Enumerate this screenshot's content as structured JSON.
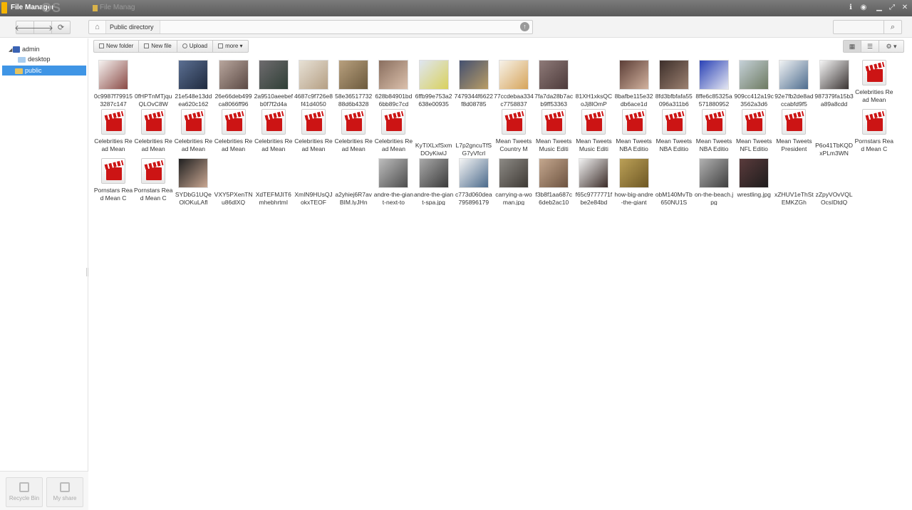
{
  "titlebar": {
    "title": "File Manager",
    "tab": "File Manag",
    "watermark": "OS"
  },
  "nav": {
    "breadcrumb": "Public directory"
  },
  "search": {
    "placeholder": ""
  },
  "tree": {
    "root": "admin",
    "children": [
      "desktop",
      "public"
    ],
    "selected": "public"
  },
  "toolbar": {
    "new_folder": "New folder",
    "new_file": "New file",
    "upload": "Upload",
    "more": "more"
  },
  "sidebar_bottom": {
    "recycle": "Recycle Bin",
    "share": "My share"
  },
  "files": [
    {
      "name": "0c9987f799153287c147",
      "kind": "image",
      "colors": [
        "#f6f3f1",
        "#8a4a45"
      ]
    },
    {
      "name": "0fHPTnMTjquQLOvC8W",
      "kind": "blank",
      "colors": [
        "#ffffff",
        "#ffffff"
      ]
    },
    {
      "name": "21e548e13ddea620c162",
      "kind": "image",
      "colors": [
        "#5b6f92",
        "#1f2a3e"
      ]
    },
    {
      "name": "26e66deb499ca8066ff96",
      "kind": "image",
      "colors": [
        "#b8a69d",
        "#5b4944"
      ]
    },
    {
      "name": "2a9510aeebefb0f7f2d4a",
      "kind": "image",
      "colors": [
        "#6e6b6e",
        "#2f3f36"
      ]
    },
    {
      "name": "4687c9f726e8f41d4050",
      "kind": "image",
      "colors": [
        "#e7e1d5",
        "#b59f84"
      ]
    },
    {
      "name": "58e3651773288d6b4328",
      "kind": "image",
      "colors": [
        "#b8a07e",
        "#6c5a3d"
      ]
    },
    {
      "name": "628b84901bd6bb89c7cd",
      "kind": "image",
      "colors": [
        "#8a6f5f",
        "#dbc0ac"
      ]
    },
    {
      "name": "6ffb99e753a2638e00935",
      "kind": "image",
      "colors": [
        "#dfe6f1",
        "#d9d15d"
      ]
    },
    {
      "name": "7479344f6622f8d08785",
      "kind": "image",
      "colors": [
        "#445070",
        "#b99d66"
      ]
    },
    {
      "name": "77ccdebaa334c7758837",
      "kind": "image",
      "colors": [
        "#f7f2e9",
        "#d6a45a"
      ]
    },
    {
      "name": "7fa7da28b7acb9ff53363",
      "kind": "image",
      "colors": [
        "#8e7a78",
        "#4c3a3a"
      ]
    },
    {
      "name": "81XH1xksQCoJj8lOmP",
      "kind": "blank",
      "colors": [
        "#ffffff",
        "#ffffff"
      ]
    },
    {
      "name": "8bafbe115e32db6ace1d",
      "kind": "image",
      "colors": [
        "#5c3e37",
        "#d2b29e"
      ]
    },
    {
      "name": "8fd3bfbfafa55096a311b6",
      "kind": "image",
      "colors": [
        "#3d2f2b",
        "#9c8170"
      ]
    },
    {
      "name": "8ffe6c85325a571880952",
      "kind": "image",
      "colors": [
        "#2a42b6",
        "#e4e6f2"
      ]
    },
    {
      "name": "909cc412a19c3562a3d6",
      "kind": "image",
      "colors": [
        "#c5d1d8",
        "#6d7a61"
      ]
    },
    {
      "name": "92e7fb2de8adccabfd9f5",
      "kind": "image",
      "colors": [
        "#f1f3f4",
        "#4d6c8e"
      ]
    },
    {
      "name": "987379fa15b3a89a8cdd",
      "kind": "image",
      "colors": [
        "#f6f6f6",
        "#3a3433"
      ]
    },
    {
      "name": "Celebrities Read Mean",
      "kind": "video",
      "colors": []
    },
    {
      "name": "Celebrities Read Mean",
      "kind": "video",
      "colors": []
    },
    {
      "name": "Celebrities Read Mean",
      "kind": "video",
      "colors": []
    },
    {
      "name": "Celebrities Read Mean",
      "kind": "video",
      "colors": []
    },
    {
      "name": "Celebrities Read Mean",
      "kind": "video",
      "colors": []
    },
    {
      "name": "Celebrities Read Mean",
      "kind": "video",
      "colors": []
    },
    {
      "name": "Celebrities Read Mean",
      "kind": "video",
      "colors": []
    },
    {
      "name": "Celebrities Read Mean",
      "kind": "video",
      "colors": []
    },
    {
      "name": "Celebrities Read Mean",
      "kind": "video",
      "colors": []
    },
    {
      "name": "KyTIXLxfSxmDOyKiwiJ",
      "kind": "blank",
      "colors": [
        "#ffffff",
        "#ffffff"
      ]
    },
    {
      "name": "L7p2gncuTfSG7yVfcrl",
      "kind": "blank",
      "colors": [
        "#ffffff",
        "#ffffff"
      ]
    },
    {
      "name": "Mean Tweets Country M",
      "kind": "video",
      "colors": []
    },
    {
      "name": "Mean Tweets Music Editi",
      "kind": "video",
      "colors": []
    },
    {
      "name": "Mean Tweets Music Editi",
      "kind": "video",
      "colors": []
    },
    {
      "name": "Mean Tweets NBA Editio",
      "kind": "video",
      "colors": []
    },
    {
      "name": "Mean Tweets NBA Editio",
      "kind": "video",
      "colors": []
    },
    {
      "name": "Mean Tweets NBA Editio",
      "kind": "video",
      "colors": []
    },
    {
      "name": "Mean Tweets NFL Editio",
      "kind": "video",
      "colors": []
    },
    {
      "name": "Mean Tweets President",
      "kind": "video",
      "colors": []
    },
    {
      "name": "P6o41TbKQDxPLm3WN",
      "kind": "blank",
      "colors": [
        "#ffffff",
        "#ffffff"
      ]
    },
    {
      "name": "Pornstars Read Mean C",
      "kind": "video",
      "colors": []
    },
    {
      "name": "Pornstars Read Mean C",
      "kind": "video",
      "colors": []
    },
    {
      "name": "Pornstars Read Mean C",
      "kind": "video",
      "colors": []
    },
    {
      "name": "SYDbG1UQeOlOKuLAfl",
      "kind": "image",
      "colors": [
        "#202020",
        "#c9a792"
      ]
    },
    {
      "name": "VXY5PXenTNu86dlXQ",
      "kind": "blank",
      "colors": [
        "#ffffff",
        "#ffffff"
      ]
    },
    {
      "name": "XdTEFMJIT6mhebhrtmI",
      "kind": "blank",
      "colors": [
        "#ffffff",
        "#ffffff"
      ]
    },
    {
      "name": "XmIN9HUsQJokxTEOF",
      "kind": "blank",
      "colors": [
        "#ffffff",
        "#ffffff"
      ]
    },
    {
      "name": "a2yhiej6R7avBIM.lyJHn",
      "kind": "blank",
      "colors": [
        "#ffffff",
        "#ffffff"
      ]
    },
    {
      "name": "andre-the-giant-next-to",
      "kind": "image",
      "colors": [
        "#bdbdbd",
        "#4d4d4d"
      ]
    },
    {
      "name": "andre-the-giant-spa.jpg",
      "kind": "image",
      "colors": [
        "#a9a9a9",
        "#3b3b3b"
      ]
    },
    {
      "name": "c773d060dea795896179",
      "kind": "image",
      "colors": [
        "#f5f5f5",
        "#4b6a8b"
      ]
    },
    {
      "name": "carrying-a-woman.jpg",
      "kind": "image",
      "colors": [
        "#8d8a85",
        "#3e3a35"
      ]
    },
    {
      "name": "f3b8f1aa687c6deb2ac10",
      "kind": "image",
      "colors": [
        "#c4a78e",
        "#6d5340"
      ]
    },
    {
      "name": "f65c9777771fbe2e84bd",
      "kind": "image",
      "colors": [
        "#f2f2f2",
        "#3b2c28"
      ]
    },
    {
      "name": "how-big-andre-the-giant",
      "kind": "image",
      "colors": [
        "#bba057",
        "#6e5824"
      ]
    },
    {
      "name": "obM140MvTb650NU1S",
      "kind": "blank",
      "colors": [
        "#ffffff",
        "#ffffff"
      ]
    },
    {
      "name": "on-the-beach.jpg",
      "kind": "image",
      "colors": [
        "#b1b1b1",
        "#3f3f3f"
      ]
    },
    {
      "name": "wrestling.jpg",
      "kind": "image",
      "colors": [
        "#5a3b3c",
        "#1e1c1c"
      ]
    },
    {
      "name": "xZHUV1eThStEMKZGh",
      "kind": "blank",
      "colors": [
        "#ffffff",
        "#ffffff"
      ]
    },
    {
      "name": "zZpyVOvVQLOcsIDtdQ",
      "kind": "blank",
      "colors": [
        "#ffffff",
        "#ffffff"
      ]
    }
  ]
}
